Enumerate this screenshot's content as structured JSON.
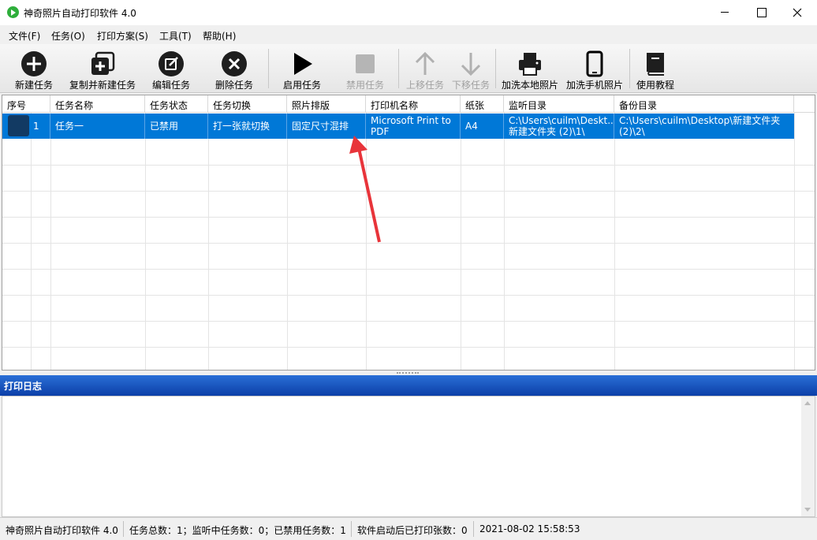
{
  "window": {
    "title": "神奇照片自动打印软件 4.0",
    "icons": [
      "app-play-icon",
      "minimize-icon",
      "maximize-icon",
      "close-icon"
    ]
  },
  "menu": [
    "文件(F)",
    "任务(O)",
    "打印方案(S)",
    "工具(T)",
    "帮助(H)"
  ],
  "toolbar": [
    {
      "label": "新建任务",
      "icon": "plus-circle-icon",
      "enabled": true
    },
    {
      "label": "复制并新建任务",
      "icon": "copy-plus-icon",
      "enabled": true
    },
    {
      "label": "编辑任务",
      "icon": "edit-icon",
      "enabled": true
    },
    {
      "label": "删除任务",
      "icon": "delete-x-icon",
      "enabled": true
    },
    {
      "label": "启用任务",
      "icon": "play-icon",
      "enabled": true
    },
    {
      "label": "禁用任务",
      "icon": "stop-icon",
      "enabled": false
    },
    {
      "label": "上移任务",
      "icon": "arrow-up-icon",
      "enabled": false
    },
    {
      "label": "下移任务",
      "icon": "arrow-down-icon",
      "enabled": false
    },
    {
      "label": "加洗本地照片",
      "icon": "printer-icon",
      "enabled": true
    },
    {
      "label": "加洗手机照片",
      "icon": "phone-icon",
      "enabled": true
    },
    {
      "label": "使用教程",
      "icon": "book-icon",
      "enabled": true
    }
  ],
  "table": {
    "columns": [
      "序号",
      "任务名称",
      "任务状态",
      "任务切换",
      "照片排版",
      "打印机名称",
      "纸张",
      "监听目录",
      "备份目录"
    ],
    "rows": [
      {
        "index": "1",
        "name": "任务一",
        "status": "已禁用",
        "switch": "打一张就切换",
        "layout": "固定尺寸混排",
        "printer_line1": "Microsoft Print to",
        "printer_line2": "PDF",
        "paper": "A4",
        "watch_line1": "C:\\Users\\cuilm\\Deskt...",
        "watch_line2": "新建文件夹 (2)\\1\\",
        "backup_line1": "C:\\Users\\cuilm\\Desktop\\新建文件夹",
        "backup_line2": "(2)\\2\\",
        "selected": true
      }
    ]
  },
  "log": {
    "title": "打印日志"
  },
  "status": {
    "app": "神奇照片自动打印软件 4.0",
    "counts": "任务总数：1；监听中任务数：0；已禁用任务数：1",
    "printed": "软件启动后已打印张数：0",
    "datetime": "2021-08-02 15:58:53"
  },
  "colors": {
    "selection": "#0078d7",
    "log_header": "#1a56c0",
    "annotation_arrow": "#e8343a"
  }
}
